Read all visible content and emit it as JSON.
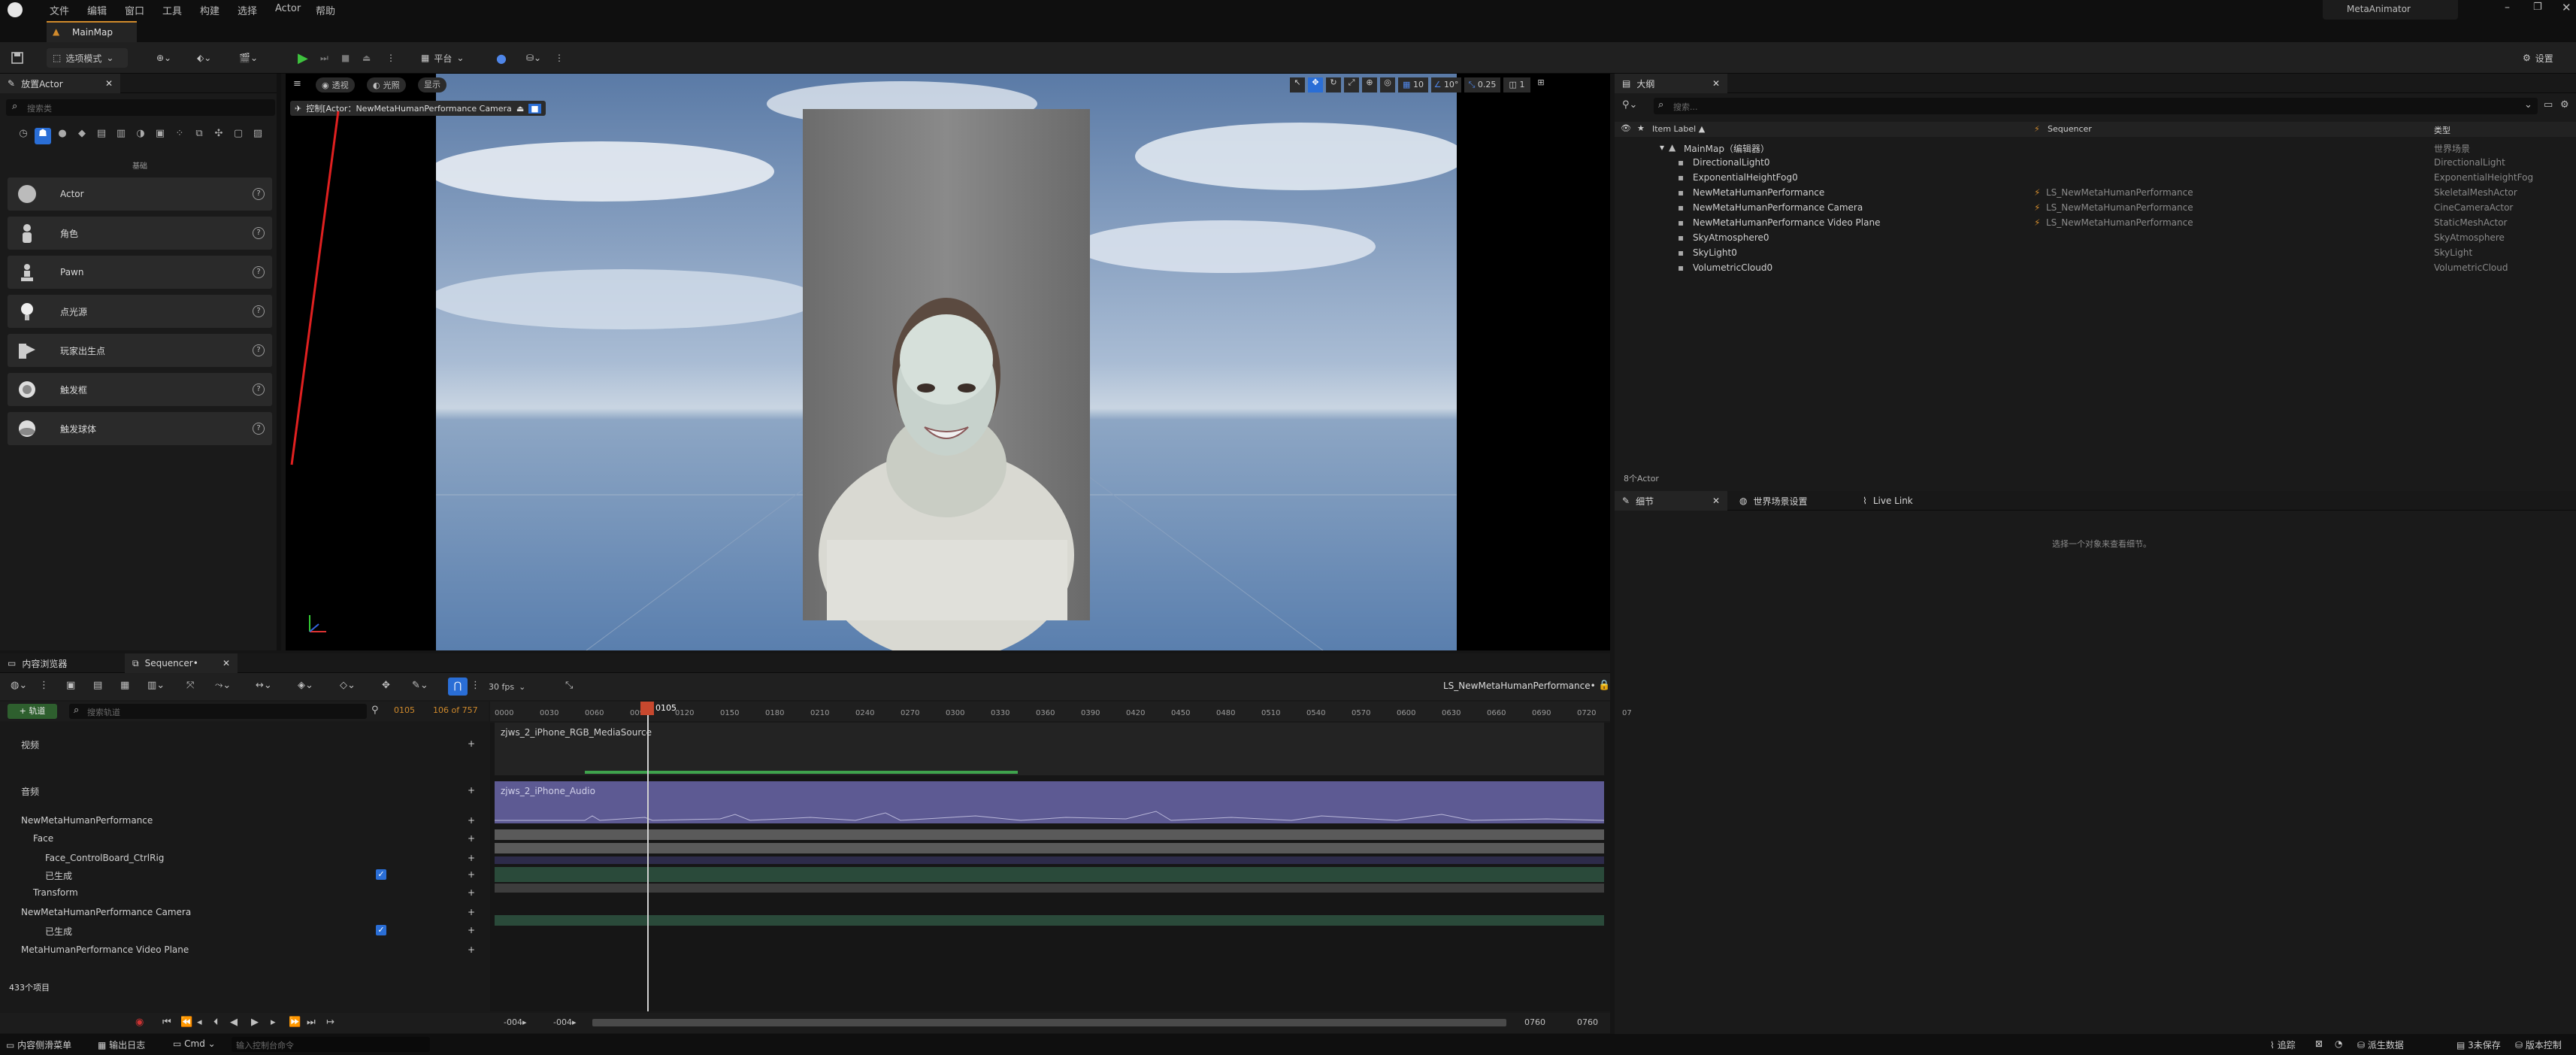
{
  "menubar": {
    "items": [
      "文件",
      "编辑",
      "窗口",
      "工具",
      "构建",
      "选择",
      "Actor",
      "帮助"
    ],
    "project": "MetaAnimator"
  },
  "tabs": {
    "main": "MainMap"
  },
  "toolbar": {
    "mode": "选项模式",
    "platform": "平台",
    "settings": "设置"
  },
  "place_actor": {
    "tab": "放置Actor",
    "search_placeholder": "搜索类",
    "category": "基础",
    "items": [
      {
        "label": "Actor",
        "icon": "sphere-icon"
      },
      {
        "label": "角色",
        "icon": "character-icon"
      },
      {
        "label": "Pawn",
        "icon": "pawn-icon"
      },
      {
        "label": "点光源",
        "icon": "point-light-icon"
      },
      {
        "label": "玩家出生点",
        "icon": "player-start-icon"
      },
      {
        "label": "触发框",
        "icon": "trigger-box-icon"
      },
      {
        "label": "触发球体",
        "icon": "trigger-sphere-icon"
      }
    ]
  },
  "viewport": {
    "perspective": "透视",
    "lit": "光照",
    "show": "显示",
    "pilot_label": "控制[Actor：NewMetaHumanPerformance Camera",
    "grid": "10",
    "angle": "10°",
    "scale": "0.25",
    "cams": "1"
  },
  "outliner": {
    "tab": "大纲",
    "search_placeholder": "搜索...",
    "col_label": "Item Label ▲",
    "col_seq": "Sequencer",
    "col_type": "类型",
    "root": "MainMap（编辑器）",
    "root_type": "世界场景",
    "rows": [
      {
        "label": "DirectionalLight0",
        "seq": "",
        "type": "DirectionalLight"
      },
      {
        "label": "ExponentialHeightFog0",
        "seq": "",
        "type": "ExponentialHeightFog"
      },
      {
        "label": "NewMetaHumanPerformance",
        "seq": "LS_NewMetaHumanPerformance",
        "type": "SkeletalMeshActor"
      },
      {
        "label": "NewMetaHumanPerformance Camera",
        "seq": "LS_NewMetaHumanPerformance",
        "type": "CineCameraActor"
      },
      {
        "label": "NewMetaHumanPerformance Video Plane",
        "seq": "LS_NewMetaHumanPerformance",
        "type": "StaticMeshActor"
      },
      {
        "label": "SkyAtmosphere0",
        "seq": "",
        "type": "SkyAtmosphere"
      },
      {
        "label": "SkyLight0",
        "seq": "",
        "type": "SkyLight"
      },
      {
        "label": "VolumetricCloud0",
        "seq": "",
        "type": "VolumetricCloud"
      }
    ],
    "count": "8个Actor"
  },
  "details": {
    "tabs": [
      "细节",
      "世界场景设置",
      "Live Link"
    ],
    "empty_msg": "选择一个对象来查看细节。"
  },
  "sequencer": {
    "tab_content": "内容浏览器",
    "tab_seq": "Sequencer•",
    "fps": "30 fps",
    "seq_name": "LS_NewMetaHumanPerformance•",
    "add_track": "+ 轨道",
    "search_placeholder": "搜索轨道",
    "frame": "0105",
    "frame_of": "106 of 757",
    "playhead": "0105",
    "ticks": [
      "0000",
      "0030",
      "0060",
      "0090",
      "0120",
      "0150",
      "0180",
      "0210",
      "0240",
      "0270",
      "0300",
      "0330",
      "0360",
      "0390",
      "0420",
      "0450",
      "0480",
      "0510",
      "0540",
      "0570",
      "0600",
      "0630",
      "0660",
      "0690",
      "0720",
      "07"
    ],
    "tracks": [
      {
        "label": "视频",
        "indent": 0
      },
      {
        "label": "音频",
        "indent": 0
      },
      {
        "label": "NewMetaHumanPerformance",
        "indent": 0
      },
      {
        "label": "Face",
        "indent": 1
      },
      {
        "label": "Face_ControlBoard_CtrlRig",
        "indent": 2
      },
      {
        "label": "已生成",
        "indent": 2
      },
      {
        "label": "Transform",
        "indent": 1
      },
      {
        "label": "NewMetaHumanPerformance Camera",
        "indent": 0
      },
      {
        "label": "已生成",
        "indent": 2
      },
      {
        "label": "MetaHumanPerformance Video Plane",
        "indent": 0
      }
    ],
    "clip_video": "zjws_2_iPhone_RGB_MediaSource",
    "clip_audio": "zjws_2_iPhone_Audio",
    "items_count": "433个项目",
    "range_start": "-004▸",
    "range_start2": "-004▸",
    "range_end": "0760",
    "range_end2": "0760"
  },
  "statusbar": {
    "drawer": "内容侧滑菜单",
    "output": "输出日志",
    "cmd": "Cmd",
    "cmd_placeholder": "输入控制台命令",
    "trace": "追踪",
    "derived": "派生数据",
    "unsaved": "3未保存",
    "revision": "版本控制"
  },
  "colors": {
    "accent": "#d08a2c",
    "select_blue": "#2a6ed6",
    "audio_clip": "#5d5a93",
    "sky_top": "#5a7aa6"
  }
}
